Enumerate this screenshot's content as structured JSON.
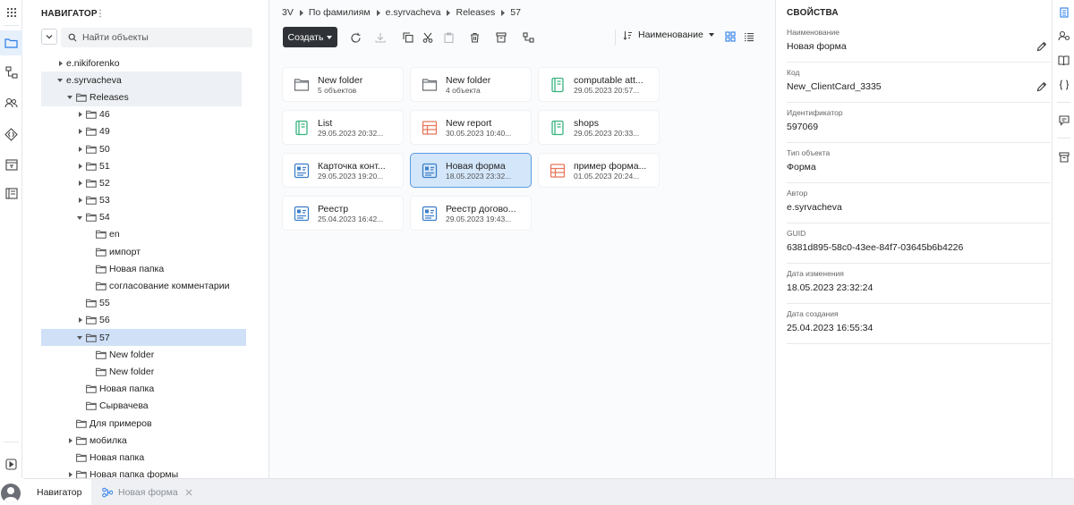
{
  "left_rail": {
    "items": [
      "apps-grid-icon",
      "folder-icon",
      "flow-icon",
      "users-icon",
      "api-icon",
      "text-box-icon",
      "book-icon",
      "play-icon",
      "user-avatar-icon"
    ]
  },
  "navigator": {
    "title": "НАВИГАТОР",
    "search_placeholder": "Найти объекты",
    "tree": [
      {
        "label": "e.nikiforenko",
        "level": 1,
        "caret": "right",
        "folder": false,
        "state": ""
      },
      {
        "label": "e.syrvacheva",
        "level": 1,
        "caret": "down",
        "folder": false,
        "state": "hl"
      },
      {
        "label": "Releases",
        "level": 2,
        "caret": "down",
        "folder": true,
        "state": "hl"
      },
      {
        "label": "46",
        "level": 3,
        "caret": "right",
        "folder": true,
        "state": ""
      },
      {
        "label": "49",
        "level": 3,
        "caret": "right",
        "folder": true,
        "state": ""
      },
      {
        "label": "50",
        "level": 3,
        "caret": "right",
        "folder": true,
        "state": ""
      },
      {
        "label": "51",
        "level": 3,
        "caret": "right",
        "folder": true,
        "state": ""
      },
      {
        "label": "52",
        "level": 3,
        "caret": "right",
        "folder": true,
        "state": ""
      },
      {
        "label": "53",
        "level": 3,
        "caret": "right",
        "folder": true,
        "state": ""
      },
      {
        "label": "54",
        "level": 3,
        "caret": "down",
        "folder": true,
        "state": ""
      },
      {
        "label": "en",
        "level": 4,
        "caret": "none",
        "folder": true,
        "state": ""
      },
      {
        "label": "импорт",
        "level": 4,
        "caret": "none",
        "folder": true,
        "state": ""
      },
      {
        "label": "Новая папка",
        "level": 4,
        "caret": "none",
        "folder": true,
        "state": ""
      },
      {
        "label": "согласование комментарии",
        "level": 4,
        "caret": "none",
        "folder": true,
        "state": ""
      },
      {
        "label": "55",
        "level": 3,
        "caret": "none",
        "folder": true,
        "state": ""
      },
      {
        "label": "56",
        "level": 3,
        "caret": "right",
        "folder": true,
        "state": ""
      },
      {
        "label": "57",
        "level": 3,
        "caret": "down",
        "folder": true,
        "state": "sel"
      },
      {
        "label": "New folder",
        "level": 4,
        "caret": "none",
        "folder": true,
        "state": ""
      },
      {
        "label": "New folder",
        "level": 4,
        "caret": "none",
        "folder": true,
        "state": ""
      },
      {
        "label": "Новая папка",
        "level": 3,
        "caret": "none",
        "folder": true,
        "state": ""
      },
      {
        "label": "Сырвачева",
        "level": 3,
        "caret": "none",
        "folder": true,
        "state": ""
      },
      {
        "label": "Для примеров",
        "level": 2,
        "caret": "none",
        "folder": true,
        "state": ""
      },
      {
        "label": "мобилка",
        "level": 2,
        "caret": "right",
        "folder": true,
        "state": ""
      },
      {
        "label": "Новая папка",
        "level": 2,
        "caret": "none",
        "folder": true,
        "state": ""
      },
      {
        "label": "Новая папка формы",
        "level": 2,
        "caret": "right",
        "folder": true,
        "state": ""
      }
    ]
  },
  "breadcrumbs": [
    "3V",
    "По фамилиям",
    "e.syrvacheva",
    "Releases",
    "57"
  ],
  "toolbar": {
    "create_label": "Создать",
    "sort_label": "Наименование",
    "icons": [
      "refresh-icon",
      "download-icon",
      "copy-icon",
      "cut-icon",
      "paste-icon",
      "delete-icon",
      "archive-icon",
      "flow-icon"
    ]
  },
  "tiles": [
    {
      "name": "New folder",
      "meta": "5 объектов",
      "type": "folder",
      "selected": false
    },
    {
      "name": "New folder",
      "meta": "4 объекта",
      "type": "folder",
      "selected": false
    },
    {
      "name": "computable att...",
      "meta": "29.05.2023 20:57...",
      "type": "book",
      "selected": false
    },
    {
      "name": "List",
      "meta": "29.05.2023 20:32...",
      "type": "book",
      "selected": false
    },
    {
      "name": "New report",
      "meta": "30.05.2023 10:40...",
      "type": "report",
      "selected": false
    },
    {
      "name": "shops",
      "meta": "29.05.2023 20:33...",
      "type": "book",
      "selected": false
    },
    {
      "name": "Карточка конт...",
      "meta": "29.05.2023 19:20...",
      "type": "form",
      "selected": false
    },
    {
      "name": "Новая форма",
      "meta": "18.05.2023 23:32...",
      "type": "form",
      "selected": true
    },
    {
      "name": "пример форма...",
      "meta": "01.05.2023 20:24...",
      "type": "report",
      "selected": false
    },
    {
      "name": "Реестр",
      "meta": "25.04.2023 16:42...",
      "type": "form",
      "selected": false
    },
    {
      "name": "Реестр догово...",
      "meta": "29.05.2023 19:43...",
      "type": "form",
      "selected": false
    }
  ],
  "properties": {
    "title": "СВОЙСТВА",
    "fields": [
      {
        "label": "Наименование",
        "value": "Новая форма",
        "editable": true
      },
      {
        "label": "Код",
        "value": "New_ClientCard_3335",
        "editable": true
      },
      {
        "label": "Идентификатор",
        "value": "597069",
        "editable": false
      },
      {
        "label": "Тип объекта",
        "value": "Форма",
        "editable": false
      },
      {
        "label": "Автор",
        "value": "e.syrvacheva",
        "editable": false
      },
      {
        "label": "GUID",
        "value": "6381d895-58c0-43ee-84f7-03645b6b4226",
        "editable": false
      },
      {
        "label": "Дата изменения",
        "value": "18.05.2023 23:32:24",
        "editable": false
      },
      {
        "label": "Дата создания",
        "value": "25.04.2023 16:55:34",
        "editable": false
      }
    ]
  },
  "right_rail": {
    "items": [
      "properties-panel-icon",
      "user-settings-icon",
      "book-icon",
      "braces-icon",
      "comment-icon",
      "archive-icon"
    ]
  },
  "bottom_tabs": [
    {
      "label": "Навигатор",
      "active": true,
      "closable": false
    },
    {
      "label": "Новая форма",
      "active": false,
      "closable": true
    }
  ],
  "colors": {
    "accent": "#2b7de9",
    "selected_bg": "#d4e6fa",
    "form_icon": "#3d7fc9",
    "book_icon": "#36b37e",
    "report_icon": "#e8765a",
    "folder_icon": "#6b6f75"
  }
}
